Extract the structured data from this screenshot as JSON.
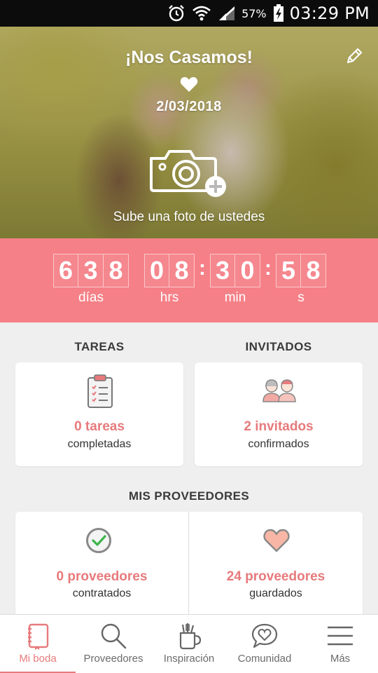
{
  "status_bar": {
    "battery": "57%",
    "time": "03:29 PM",
    "icons": [
      "alarm-icon",
      "wifi-icon",
      "signal-icon",
      "battery-charging-icon"
    ]
  },
  "hero": {
    "title": "¡Nos Casamos!",
    "date": "2/03/2018",
    "upload_label": "Sube una foto de ustedes"
  },
  "countdown": {
    "days": [
      "6",
      "3",
      "8"
    ],
    "hours": [
      "0",
      "8"
    ],
    "minutes": [
      "3",
      "0"
    ],
    "seconds": [
      "5",
      "8"
    ],
    "labels": {
      "days": "días",
      "hours": "hrs",
      "minutes": "min",
      "seconds": "s"
    }
  },
  "tasks": {
    "section_title": "TAREAS",
    "value": "0 tareas",
    "caption": "completadas"
  },
  "guests": {
    "section_title": "INVITADOS",
    "value": "2 invitados",
    "caption": "confirmados"
  },
  "vendors": {
    "section_title": "MIS PROVEEDORES",
    "hired": {
      "value": "0 proveedores",
      "caption": "contratados"
    },
    "saved": {
      "value": "24 proveedores",
      "caption": "guardados"
    }
  },
  "nav": {
    "active": "Mi boda",
    "items": [
      {
        "label": "Mi boda",
        "icon": "notebook-icon"
      },
      {
        "label": "Proveedores",
        "icon": "search-icon"
      },
      {
        "label": "Inspiración",
        "icon": "inspiration-cup-icon"
      },
      {
        "label": "Comunidad",
        "icon": "chat-heart-icon"
      },
      {
        "label": "Más",
        "icon": "menu-icon"
      }
    ]
  },
  "colors": {
    "accent": "#f58087",
    "accent_text": "#e77a7c",
    "background": "#efefef"
  }
}
